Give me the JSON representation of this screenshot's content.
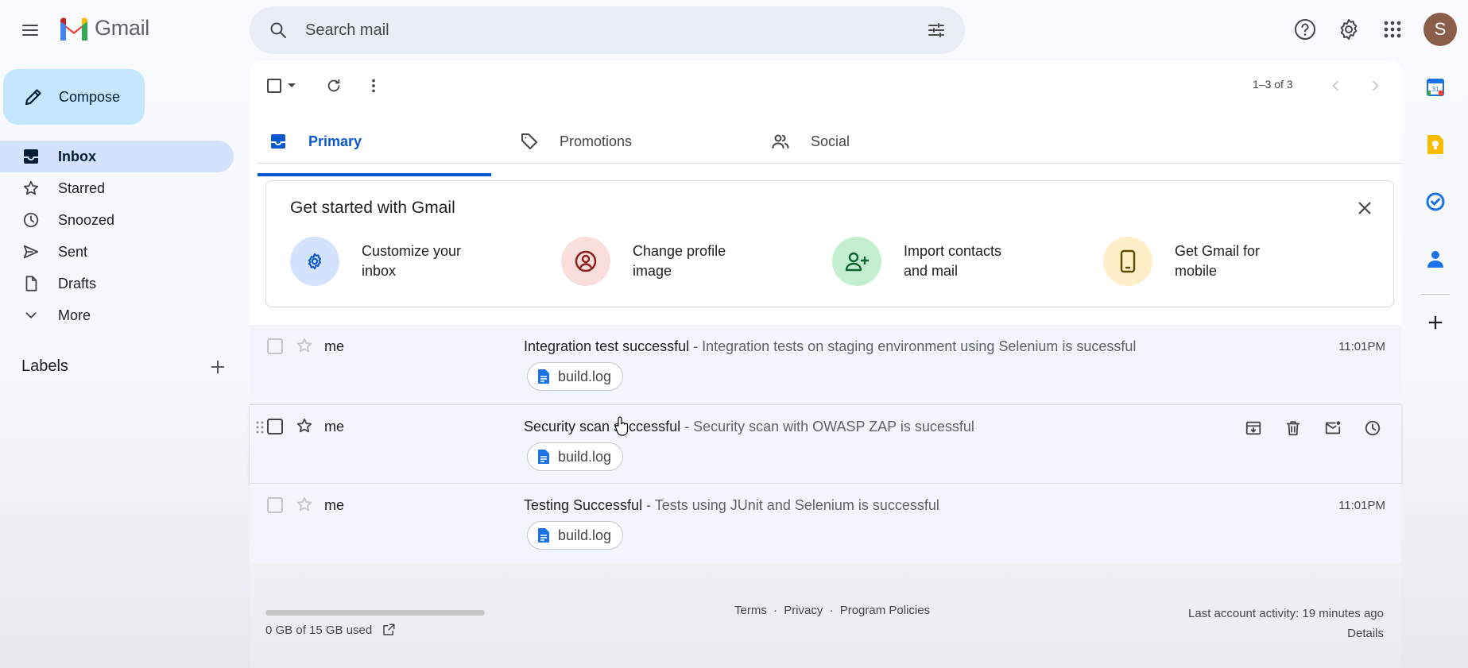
{
  "app": {
    "name": "Gmail",
    "avatar_initial": "S"
  },
  "search": {
    "placeholder": "Search mail"
  },
  "compose": {
    "label": "Compose"
  },
  "nav": {
    "items": [
      {
        "label": "Inbox",
        "icon": "inbox-icon",
        "active": true
      },
      {
        "label": "Starred",
        "icon": "star-icon"
      },
      {
        "label": "Snoozed",
        "icon": "clock-icon"
      },
      {
        "label": "Sent",
        "icon": "send-icon"
      },
      {
        "label": "Drafts",
        "icon": "draft-icon"
      },
      {
        "label": "More",
        "icon": "chevron-down-icon"
      }
    ],
    "labels_heading": "Labels"
  },
  "toolbar": {
    "range": "1–3 of 3"
  },
  "tabs": [
    {
      "label": "Primary",
      "icon": "inbox-tab-icon",
      "active": true
    },
    {
      "label": "Promotions",
      "icon": "tag-icon"
    },
    {
      "label": "Social",
      "icon": "people-icon"
    }
  ],
  "welcome": {
    "title": "Get started with Gmail",
    "items": [
      {
        "line1": "Customize your",
        "line2": "inbox",
        "icon": "gear-icon",
        "color": "#d3e3fd"
      },
      {
        "line1": "Change profile",
        "line2": "image",
        "icon": "account-circle-icon",
        "color": "#f9dedc"
      },
      {
        "line1": "Import contacts",
        "line2": "and mail",
        "icon": "person-add-icon",
        "color": "#c4eed0"
      },
      {
        "line1": "Get Gmail for",
        "line2": "mobile",
        "icon": "phone-icon",
        "color": "#ffefc9"
      }
    ]
  },
  "emails": [
    {
      "sender": "me",
      "subject": "Integration test successful",
      "separator": " - ",
      "snippet": "Integration tests on staging environment using Selenium is sucessful",
      "time": "11:01PM",
      "attachment": "build.log"
    },
    {
      "sender": "me",
      "subject": "Security scan successful",
      "separator": " - ",
      "snippet": "Security scan with OWASP ZAP is sucessful",
      "time": "",
      "attachment": "build.log"
    },
    {
      "sender": "me",
      "subject": "Testing Successful",
      "separator": " - ",
      "snippet": "Tests using JUnit and Selenium is successful",
      "time": "11:01PM",
      "attachment": "build.log"
    }
  ],
  "footer": {
    "storage": "0 GB of 15 GB used",
    "terms": "Terms",
    "privacy": "Privacy",
    "policies": "Program Policies",
    "dot": "·",
    "activity": "Last account activity: 19 minutes ago",
    "details": "Details"
  },
  "colors": {
    "accent": "#0b57d0",
    "compose_bg": "#c2e7ff",
    "nav_active_bg": "#d3e3fd"
  }
}
